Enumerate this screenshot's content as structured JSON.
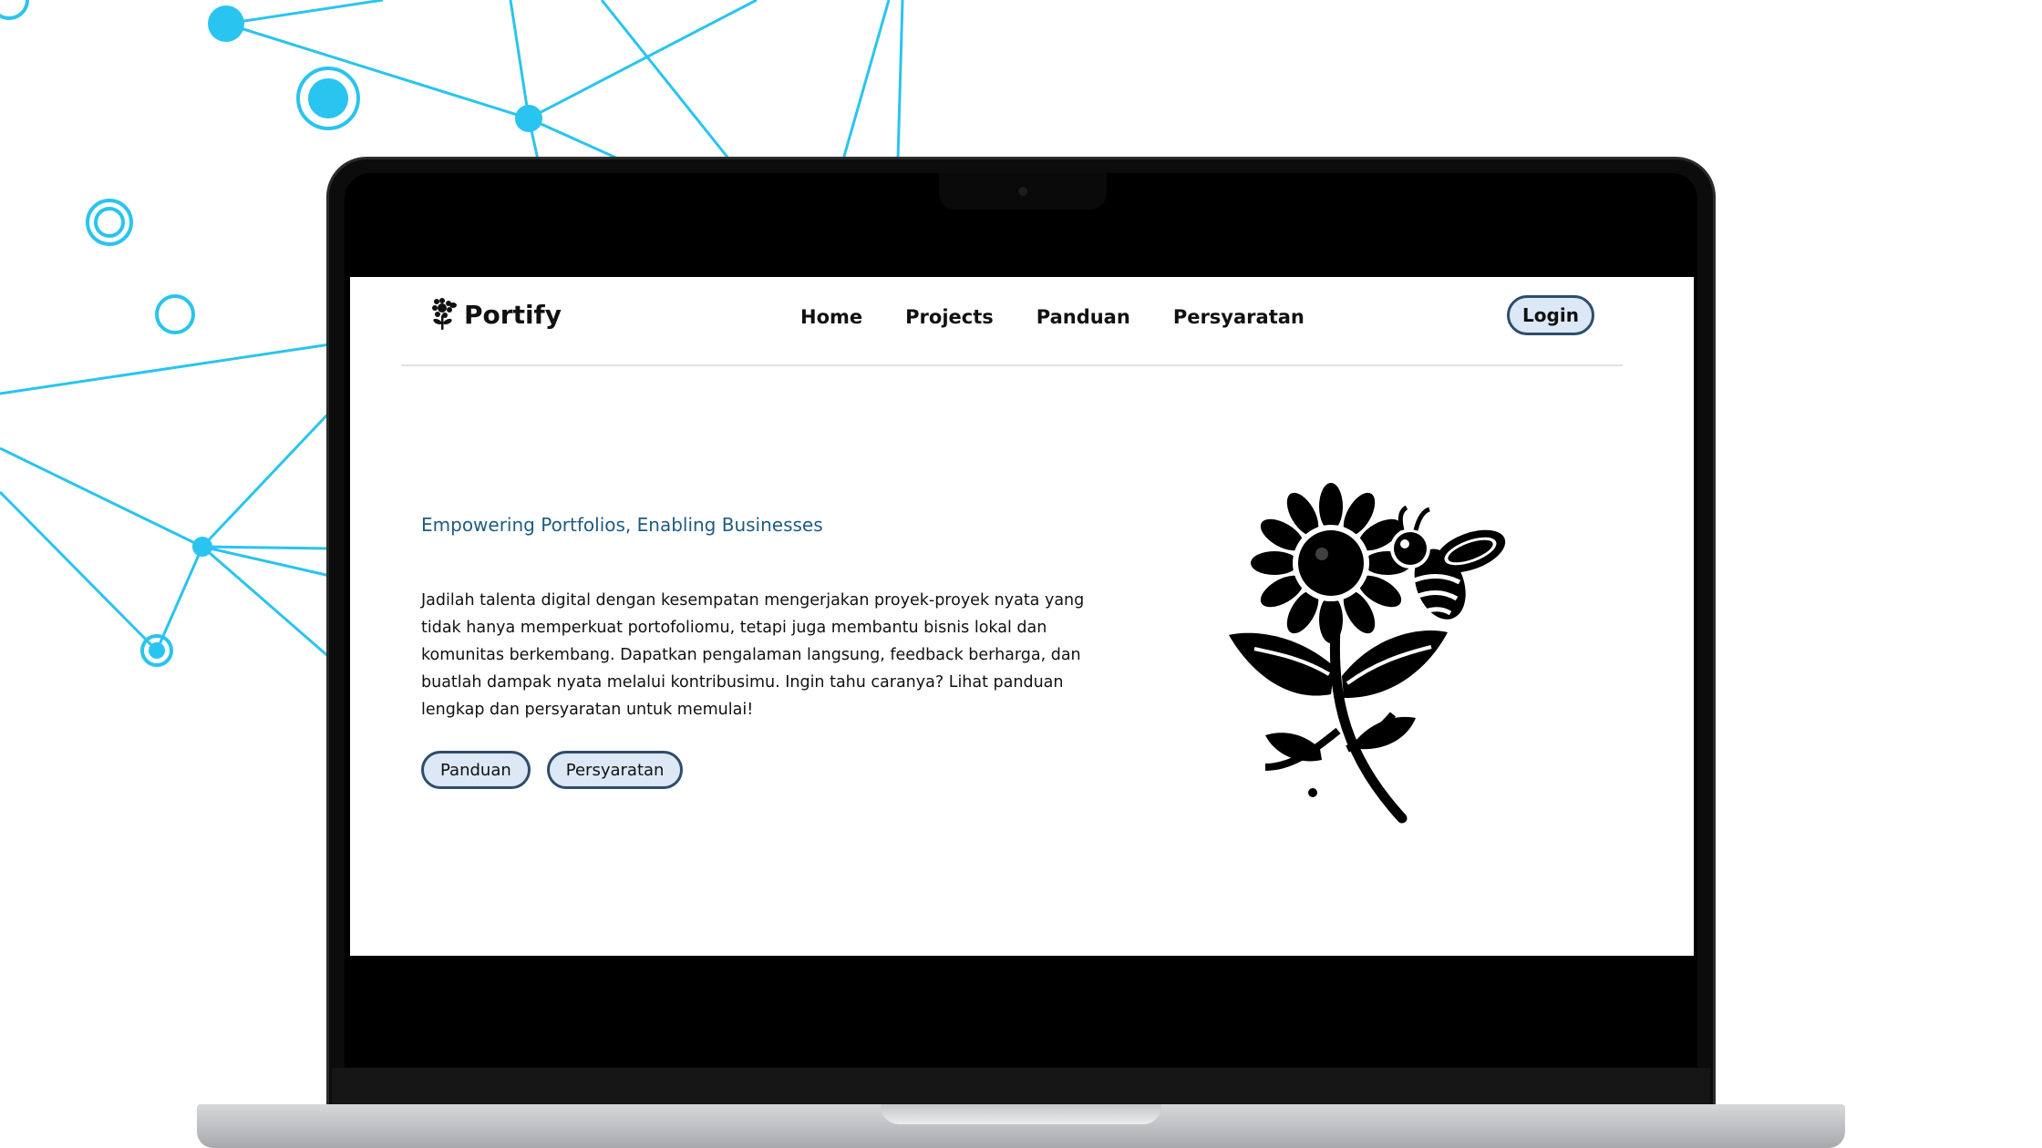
{
  "brand": {
    "name": "Portify",
    "logo_icon": "flower-bee-icon"
  },
  "nav": {
    "items": [
      "Home",
      "Projects",
      "Panduan",
      "Persyaratan"
    ],
    "login_label": "Login"
  },
  "hero": {
    "tagline": "Empowering Portfolios, Enabling Businesses",
    "description": "Jadilah talenta digital dengan kesempatan mengerjakan proyek-proyek nyata yang tidak hanya memperkuat portofoliomu, tetapi juga membantu bisnis lokal dan komunitas berkembang. Dapatkan pengalaman langsung, feedback berharga, dan buatlah dampak nyata melalui kontribusimu. Ingin tahu caranya? Lihat panduan lengkap dan persyaratan untuk memulai!",
    "buttons": [
      "Panduan",
      "Persyaratan"
    ],
    "illustration": "sunflower-bee-icon"
  },
  "colors": {
    "accent": "#2e4d6c",
    "button_fill": "#dce8f5",
    "tagline": "#1f5b80",
    "network": "#29c4ef"
  }
}
